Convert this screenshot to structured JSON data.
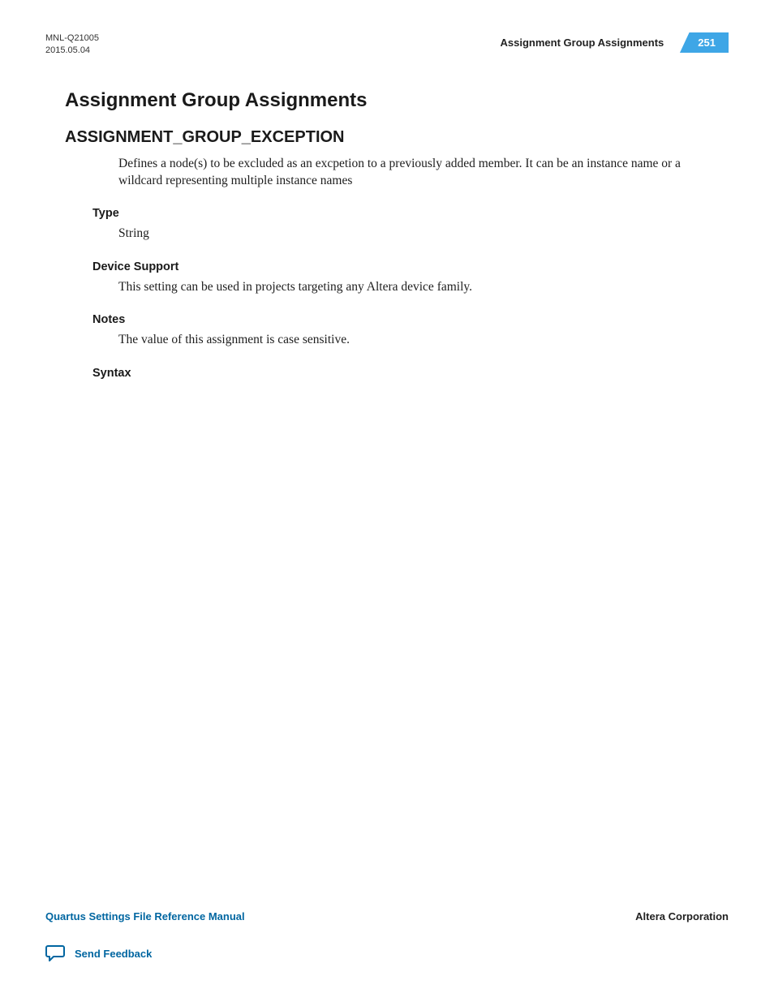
{
  "header": {
    "doc_id": "MNL-Q21005",
    "date": "2015.05.04",
    "section_title": "Assignment Group Assignments",
    "page_number": "251"
  },
  "content": {
    "h1": "Assignment Group Assignments",
    "h2": "ASSIGNMENT_GROUP_EXCEPTION",
    "intro": "Defines a node(s) to be excluded as an excpetion to a previously added member. It can be an instance name or a wildcard representing multiple instance names",
    "sections": {
      "type": {
        "label": "Type",
        "body": "String"
      },
      "device_support": {
        "label": "Device Support",
        "body": "This setting can be used in projects targeting any Altera device family."
      },
      "notes": {
        "label": "Notes",
        "body": "The value of this assignment is case sensitive."
      },
      "syntax": {
        "label": "Syntax"
      }
    }
  },
  "footer": {
    "manual_title": "Quartus Settings File Reference Manual",
    "corp": "Altera Corporation",
    "feedback": "Send Feedback"
  },
  "colors": {
    "accent": "#3ea6e6",
    "link": "#0066a1"
  }
}
